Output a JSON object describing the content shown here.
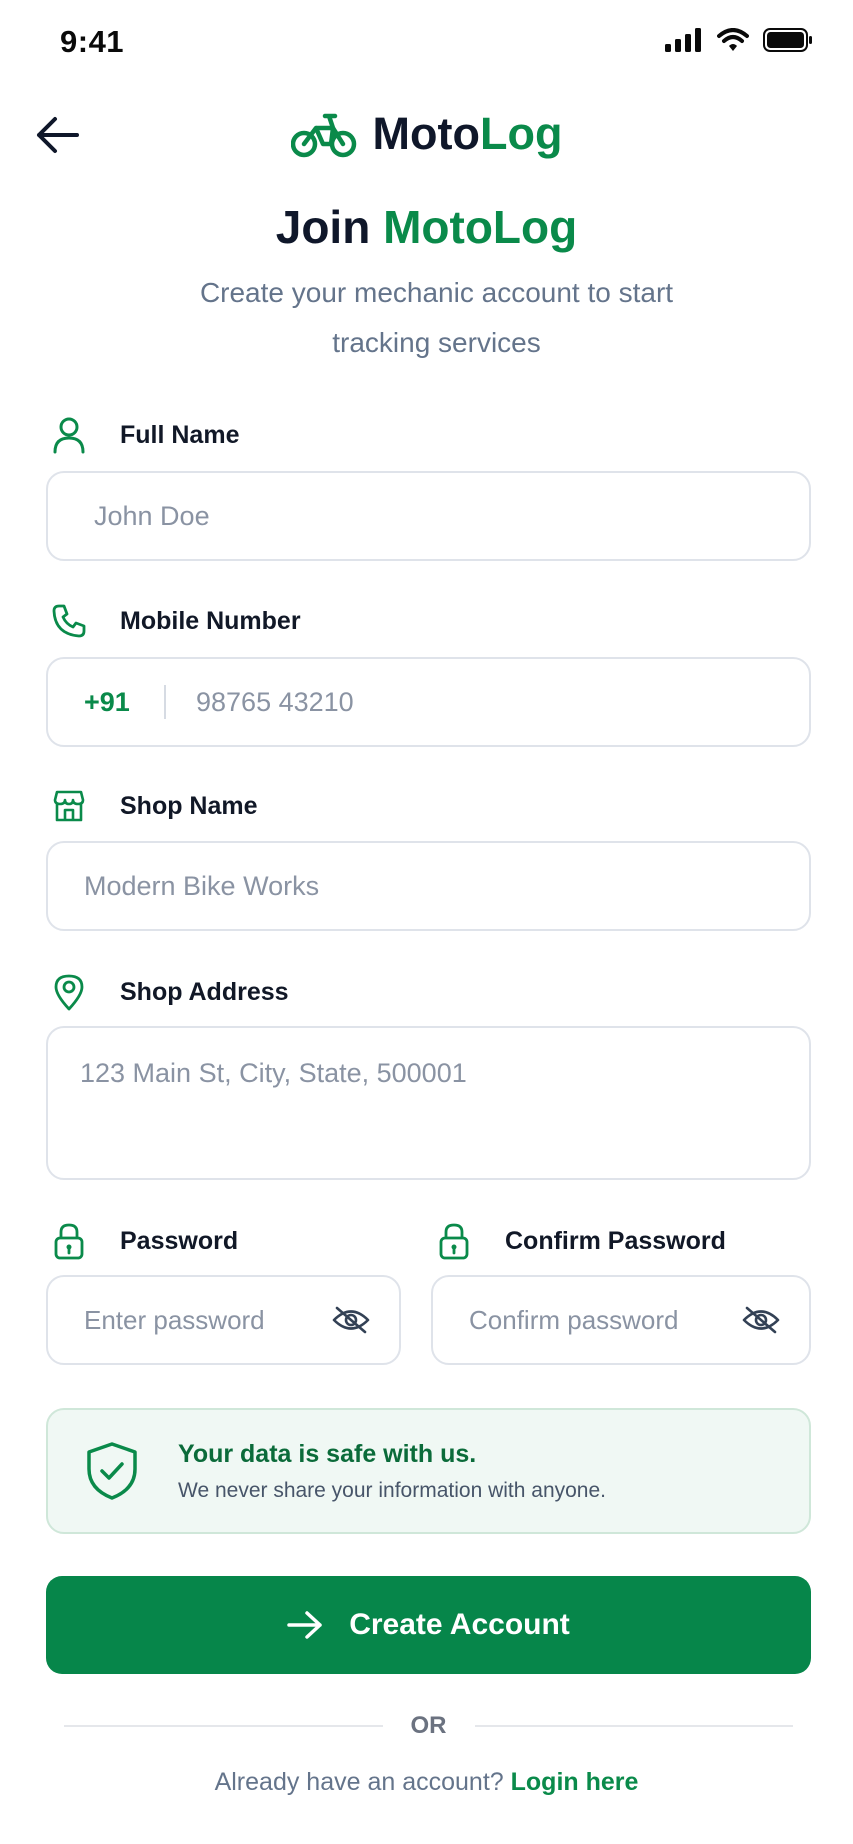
{
  "status_bar": {
    "time": "9:41"
  },
  "header": {
    "logo_prefix": "Moto",
    "logo_suffix": "Log",
    "title_prefix": "Join",
    "title_accent": "MotoLog",
    "subtitle": "Create your mechanic account to start tracking services"
  },
  "form": {
    "full_name": {
      "label": "Full Name",
      "placeholder": "John Doe"
    },
    "mobile": {
      "label": "Mobile Number",
      "country_code": "+91",
      "placeholder": "98765 43210"
    },
    "shop_name": {
      "label": "Shop Name",
      "placeholder": "Modern Bike Works"
    },
    "shop_address": {
      "label": "Shop Address",
      "placeholder": "123 Main St, City, State, 500001"
    },
    "password": {
      "label": "Password",
      "placeholder": "Enter password"
    },
    "confirm_password": {
      "label": "Confirm Password",
      "placeholder": "Confirm password"
    }
  },
  "security_note": {
    "title": "Your data is safe with us.",
    "subtitle": "We never share your information with anyone."
  },
  "actions": {
    "create_account": "Create Account",
    "or": "OR",
    "login_prompt": "Already have an account?",
    "login_link": "Login here"
  },
  "colors": {
    "brand_green": "#0a8a4a",
    "button_green": "#06864a",
    "text_dark": "#0f172a",
    "muted": "#64748b"
  },
  "icons": [
    "back-arrow-icon",
    "motorcycle-icon",
    "user-icon",
    "phone-icon",
    "store-icon",
    "location-pin-icon",
    "lock-icon",
    "eye-off-icon",
    "shield-check-icon",
    "arrow-right-icon",
    "signal-icon",
    "wifi-icon",
    "battery-icon"
  ]
}
